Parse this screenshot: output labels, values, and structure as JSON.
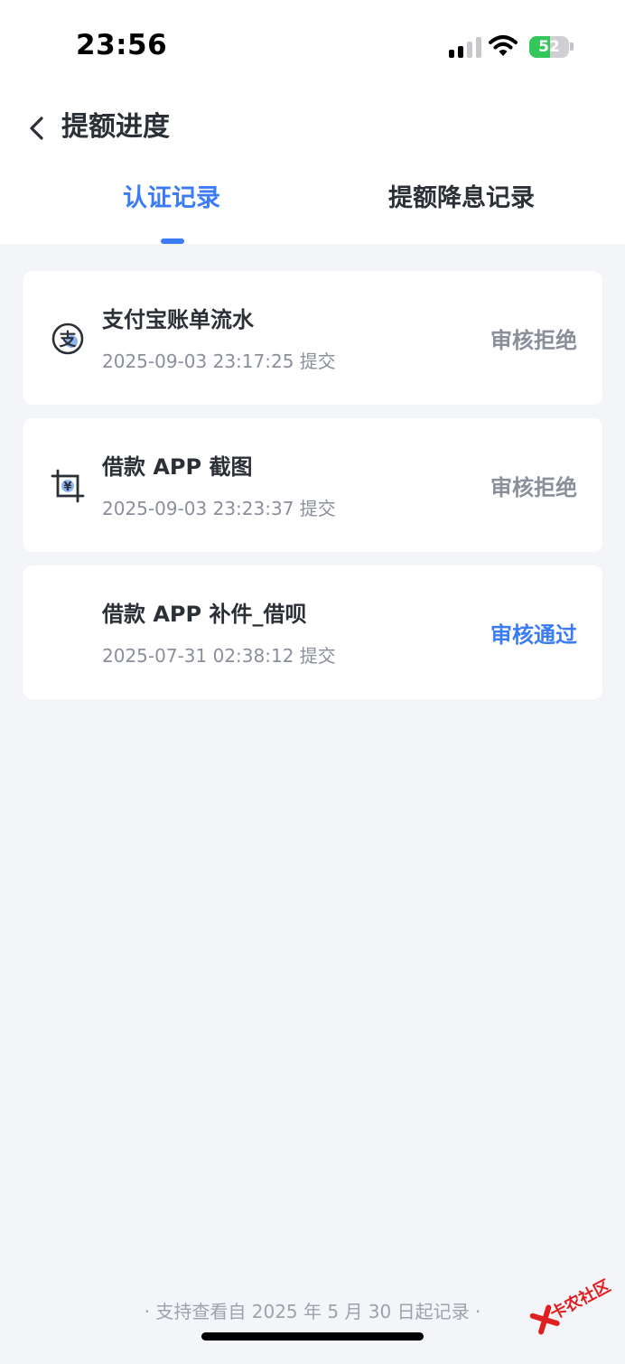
{
  "status_bar": {
    "time": "23:56",
    "battery_percent": 52
  },
  "nav": {
    "title": "提额进度"
  },
  "tabs": [
    {
      "label": "认证记录",
      "active": true
    },
    {
      "label": "提额降息记录",
      "active": false
    }
  ],
  "records": [
    {
      "icon": "alipay-icon",
      "title": "支付宝账单流水",
      "submitted": "2025-09-03 23:17:25 提交",
      "status": "审核拒绝",
      "status_color": "#8a8f99"
    },
    {
      "icon": "screenshot-crop-icon",
      "title": "借款 APP 截图",
      "submitted": "2025-09-03 23:23:37 提交",
      "status": "审核拒绝",
      "status_color": "#8a8f99"
    },
    {
      "icon": "",
      "title": "借款 APP 补件_借呗",
      "submitted": "2025-07-31 02:38:12 提交",
      "status": "审核通过",
      "status_color": "#3b7cf5"
    }
  ],
  "footer": {
    "note": "· 支持查看自 2025 年 5 月 30 日起记录 ·"
  },
  "watermark": {
    "text": "卡农社区"
  },
  "colors": {
    "accent": "#3b7cf5",
    "text": "#2b2f36",
    "muted": "#8a8f99",
    "background": "#f4f5f9"
  }
}
